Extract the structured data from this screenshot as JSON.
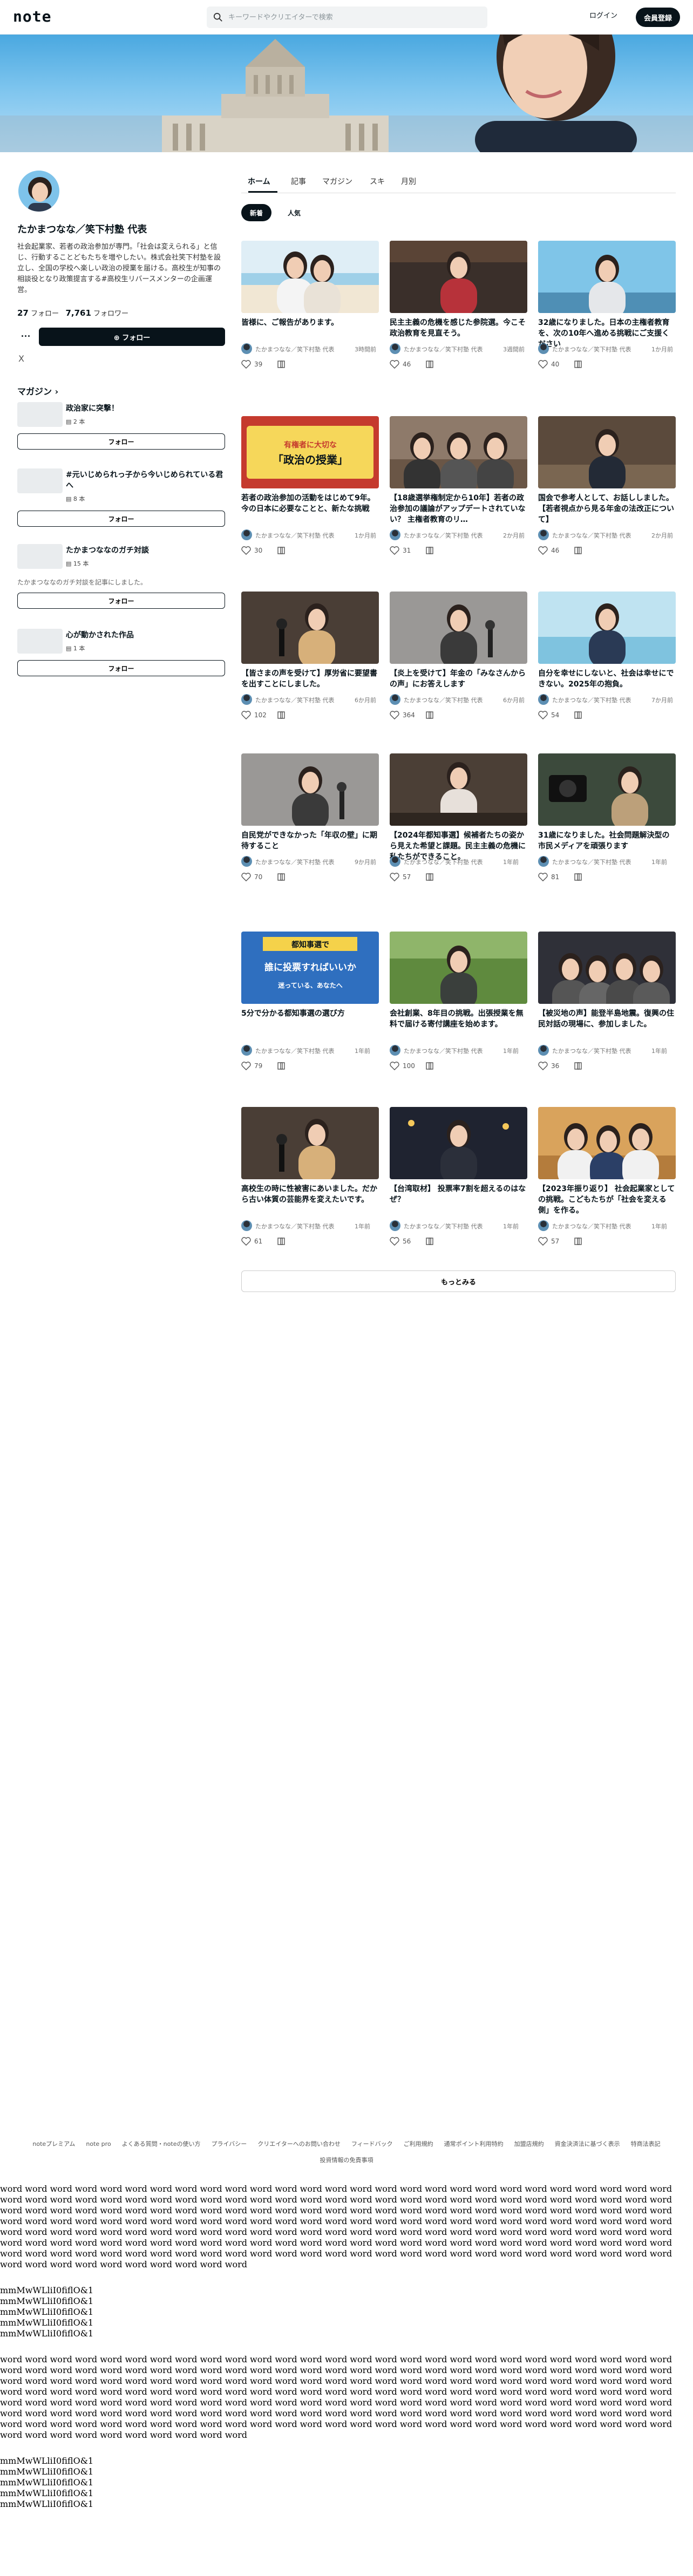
{
  "header": {
    "logo": "note",
    "search_placeholder": "キーワードやクリエイターで検索",
    "login": "ログイン",
    "signup": "会員登録"
  },
  "profile": {
    "name": "たかまつなな／笑下村塾 代表",
    "bio": "社会起業家、若者の政治参加が専門。「社会は変えられる」と信じ、行動することどもたちを増やしたい。株式会社笑下村塾を設立し、全国の学校へ楽しい政治の授業を届ける。高校生が知事の相談役となり政策提言する#高校生リバースメンターの企画運営。",
    "following_count": "27",
    "following_label": "フォロー",
    "followers_count": "7,761",
    "followers_label": "フォロワー",
    "follow_button": "フォロー",
    "x_icon": "X"
  },
  "magazines": {
    "heading": "マガジン",
    "items": [
      {
        "title": "政治家に突撃！",
        "count": "2 本",
        "desc": "",
        "follow": "フォロー"
      },
      {
        "title": "#元いじめられっ子から今いじめられている君へ",
        "count": "8 本",
        "desc": "",
        "follow": "フォロー"
      },
      {
        "title": "たかまつななのガチ対談",
        "count": "15 本",
        "desc": "たかまつななのガチ対談を記事にしました。",
        "follow": "フォロー"
      },
      {
        "title": "心が動かされた作品",
        "count": "1 本",
        "desc": "",
        "follow": "フォロー"
      }
    ]
  },
  "tabs": [
    "ホーム",
    "記事",
    "マガジン",
    "スキ",
    "月別"
  ],
  "pills": [
    "新着",
    "人気"
  ],
  "articles": [
    {
      "title": "皆様に、ご報告があります。",
      "author": "たかまつなな／笑下村塾 代表",
      "time": "3時間前",
      "likes": "39",
      "img": "beach"
    },
    {
      "title": "民主主義の危機を感じた参院選。今こそ政治教育を見直そう。",
      "author": "たかまつなな／笑下村塾 代表",
      "time": "3週間前",
      "likes": "46",
      "img": "stage"
    },
    {
      "title": "32歳になりました。日本の主権者教育を、次の10年へ進める挑戦にご支援ください",
      "author": "たかまつなな／笑下村塾 代表",
      "time": "1か月前",
      "likes": "40",
      "img": "portrait-sky"
    },
    {
      "title": "若者の政治参加の活動をはじめて9年。今の日本に必要なことと、新たな挑戦",
      "author": "たかまつなな／笑下村塾 代表",
      "time": "1か月前",
      "likes": "30",
      "img": "banner-red"
    },
    {
      "title": "【18歳選挙権制定から10年】若者の政治参加の議論がアップデートされていない？ 主権者教育のリ…",
      "author": "たかまつなな／笑下村塾 代表",
      "time": "2か月前",
      "likes": "31",
      "img": "meeting"
    },
    {
      "title": "国会で参考人として、お話ししました。【若者視点から見る年金の法改正について】",
      "author": "たかまつなな／笑下村塾 代表",
      "time": "2か月前",
      "likes": "46",
      "img": "diet"
    },
    {
      "title": "【皆さまの声を受けて】厚労省に要望書を出すことにしました。",
      "author": "たかまつなな／笑下村塾 代表",
      "time": "6か月前",
      "likes": "102",
      "img": "mic-dark"
    },
    {
      "title": "【炎上を受けて】年金の「みなさんからの声」にお答えします",
      "author": "たかまつなな／笑下村塾 代表",
      "time": "6か月前",
      "likes": "364",
      "img": "mic-grey"
    },
    {
      "title": "自分を幸せにしないと、社会は幸せにできない。2025年の抱負。",
      "author": "たかまつなな／笑下村塾 代表",
      "time": "7か月前",
      "likes": "54",
      "img": "sea"
    },
    {
      "title": "自民党ができなかった「年収の壁」に期待すること",
      "author": "たかまつなな／笑下村塾 代表",
      "time": "9か月前",
      "likes": "70",
      "img": "mic-grey"
    },
    {
      "title": "【2024年都知事選】候補者たちの姿から見えた希望と課題。民主主義の危機に私たちができること。",
      "author": "たかまつなな／笑下村塾 代表",
      "time": "1年前",
      "likes": "57",
      "img": "crowd"
    },
    {
      "title": "31歳になりました。社会問題解決型の市民メディアを頑張ります",
      "author": "たかまつなな／笑下村塾 代表",
      "time": "1年前",
      "likes": "81",
      "img": "camera"
    },
    {
      "title": "5分で分かる都知事選の選び方",
      "author": "たかまつなな／笑下村塾 代表",
      "time": "1年前",
      "likes": "79",
      "img": "blue-title"
    },
    {
      "title": "会社創業、8年目の挑戦。出張授業を無料で届ける寄付講座を始めます。",
      "author": "たかまつなな／笑下村塾 代表",
      "time": "1年前",
      "likes": "100",
      "img": "park"
    },
    {
      "title": "【被災地の声】能登半島地震。復興の住民対話の現場に、参加しました。",
      "author": "たかまつなな／笑下村塾 代表",
      "time": "1年前",
      "likes": "36",
      "img": "hall"
    },
    {
      "title": "高校生の時に性被害にあいました。だから古い体質の芸能界を変えたいです。",
      "author": "たかまつなな／笑下村塾 代表",
      "time": "1年前",
      "likes": "61",
      "img": "mic-dark"
    },
    {
      "title": "【台湾取材】 投票率7割を超えるのはなぜ？",
      "author": "たかまつなな／笑下村塾 代表",
      "time": "1年前",
      "likes": "56",
      "img": "night"
    },
    {
      "title": "【2023年振り返り】 社会起業家としての挑戦。こどもたちが「社会を変える側」を作る。",
      "author": "たかまつなな／笑下村塾 代表",
      "time": "1年前",
      "likes": "57",
      "img": "class"
    }
  ],
  "thumb_text": {
    "banner_red_1": "有権者に大切な",
    "banner_red_2": "「政治の授業」",
    "blue_title_1": "都知事選で",
    "blue_title_2": "誰に投票すればいいか",
    "blue_title_3": "迷っている、あなたへ"
  },
  "see_more": "もっとみる",
  "footer": {
    "links": [
      "noteプレミアム",
      "note pro",
      "よくある質問・noteの使い方",
      "プライバシー",
      "クリエイターへのお問い合わせ",
      "フィードバック",
      "ご利用規約",
      "通常ポイント利用特約",
      "加盟店規約",
      "資金決済法に基づく表示",
      "特商法表記"
    ],
    "links2": [
      "投資情報の免責事項"
    ]
  },
  "debug_text": {
    "words": "word word word word word word word word word word word word word word word word word word word word word word word word word word word word word word word word word word word word word word word word word word word word word word word word word word word word word word word word word word word word word word word word word word word word word word word word word word word word word word word word word word word word word word word word word word word word word word word word word word word word word word word word word word word word word word word word word word word word word word word word word word word word word word word word word word word word word word word word word word word word word word word word word word word word word word word word word word word word word word word word word word word word word word word word word word word word word word word word word word word word word word word word word word word word word word word word word word word word word word word",
    "lines": [
      "mmMwWLliI0fiflO&1",
      "mmMwWLliI0fiflO&1",
      "mmMwWLliI0fiflO&1",
      "mmMwWLliI0fiflO&1",
      "mmMwWLliI0fiflO&1"
    ]
  },
  "colors": {
    "brand": "#08131a",
    "banner_sky": "#4aa8e0"
  }
}
